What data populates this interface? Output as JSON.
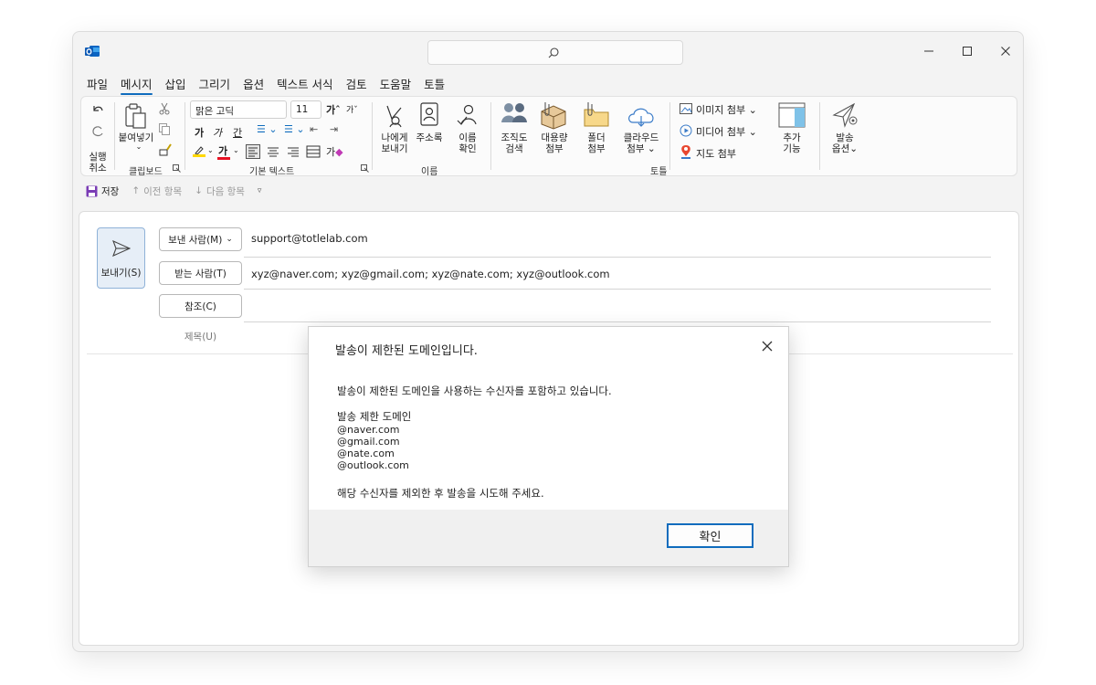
{
  "window": {
    "search_icon": "search-icon",
    "controls": {
      "minimize": "—",
      "maximize": "☐",
      "close": "✕"
    }
  },
  "menu": [
    "파일",
    "메시지",
    "삽입",
    "그리기",
    "옵션",
    "텍스트 서식",
    "검토",
    "도움말",
    "토틀"
  ],
  "menu_active": "메시지",
  "ribbon": {
    "undo_label_1": "실행",
    "undo_label_2": "취소",
    "paste_label": "붙여넣기",
    "clipboard_group": "클립보드",
    "font_name": "맑은 고딕",
    "font_size": "11",
    "basic_text_group": "기본 텍스트",
    "send_to_me_1": "나에게",
    "send_to_me_2": "보내기",
    "address_book": "주소록",
    "check_names_1": "이름",
    "check_names_2": "확인",
    "names_group": "이름",
    "org_search_1": "조직도",
    "org_search_2": "검색",
    "large_attach_1": "대용량",
    "large_attach_2": "첨부",
    "folder_attach_1": "폴더",
    "folder_attach_2": "첨부",
    "cloud_attach_1": "클라우드",
    "cloud_attach_2": "첨부",
    "image_attach": "이미지 첨부",
    "media_attach": "미디어 첨부",
    "map_attach": "지도 첨부",
    "add_feature_1": "추가",
    "add_feature_2": "기능",
    "totle_group": "토틀",
    "send_options_1": "발송",
    "send_options_2": "옵션"
  },
  "qat": {
    "save": "저장",
    "prev": "이전 항목",
    "next": "다음 항목"
  },
  "compose": {
    "send_label": "보내기(S)",
    "from_label": "보낸 사람(M)",
    "from_value": "support@totlelab.com",
    "to_label": "받는 사람(T)",
    "to_value": "xyz@naver.com; xyz@gmail.com; xyz@nate.com; xyz@outlook.com",
    "cc_label": "참조(C)",
    "subject_label": "제목(U)"
  },
  "dialog": {
    "title": "발송이 제한된 도메인입니다.",
    "message": "발송이 제한된 도메인을 사용하는 수신자를 포함하고 있습니다.",
    "domains_heading": "발송 제한 도메인",
    "domains": [
      "@naver.com",
      "@gmail.com",
      "@nate.com",
      "@outlook.com"
    ],
    "instruction": "해당 수신자를 제외한 후 발송을 시도해 주세요.",
    "ok_label": "확인"
  },
  "colors": {
    "accent": "#0f6cbd",
    "highlight_yellow": "#ffd800",
    "font_red": "#e81123"
  }
}
